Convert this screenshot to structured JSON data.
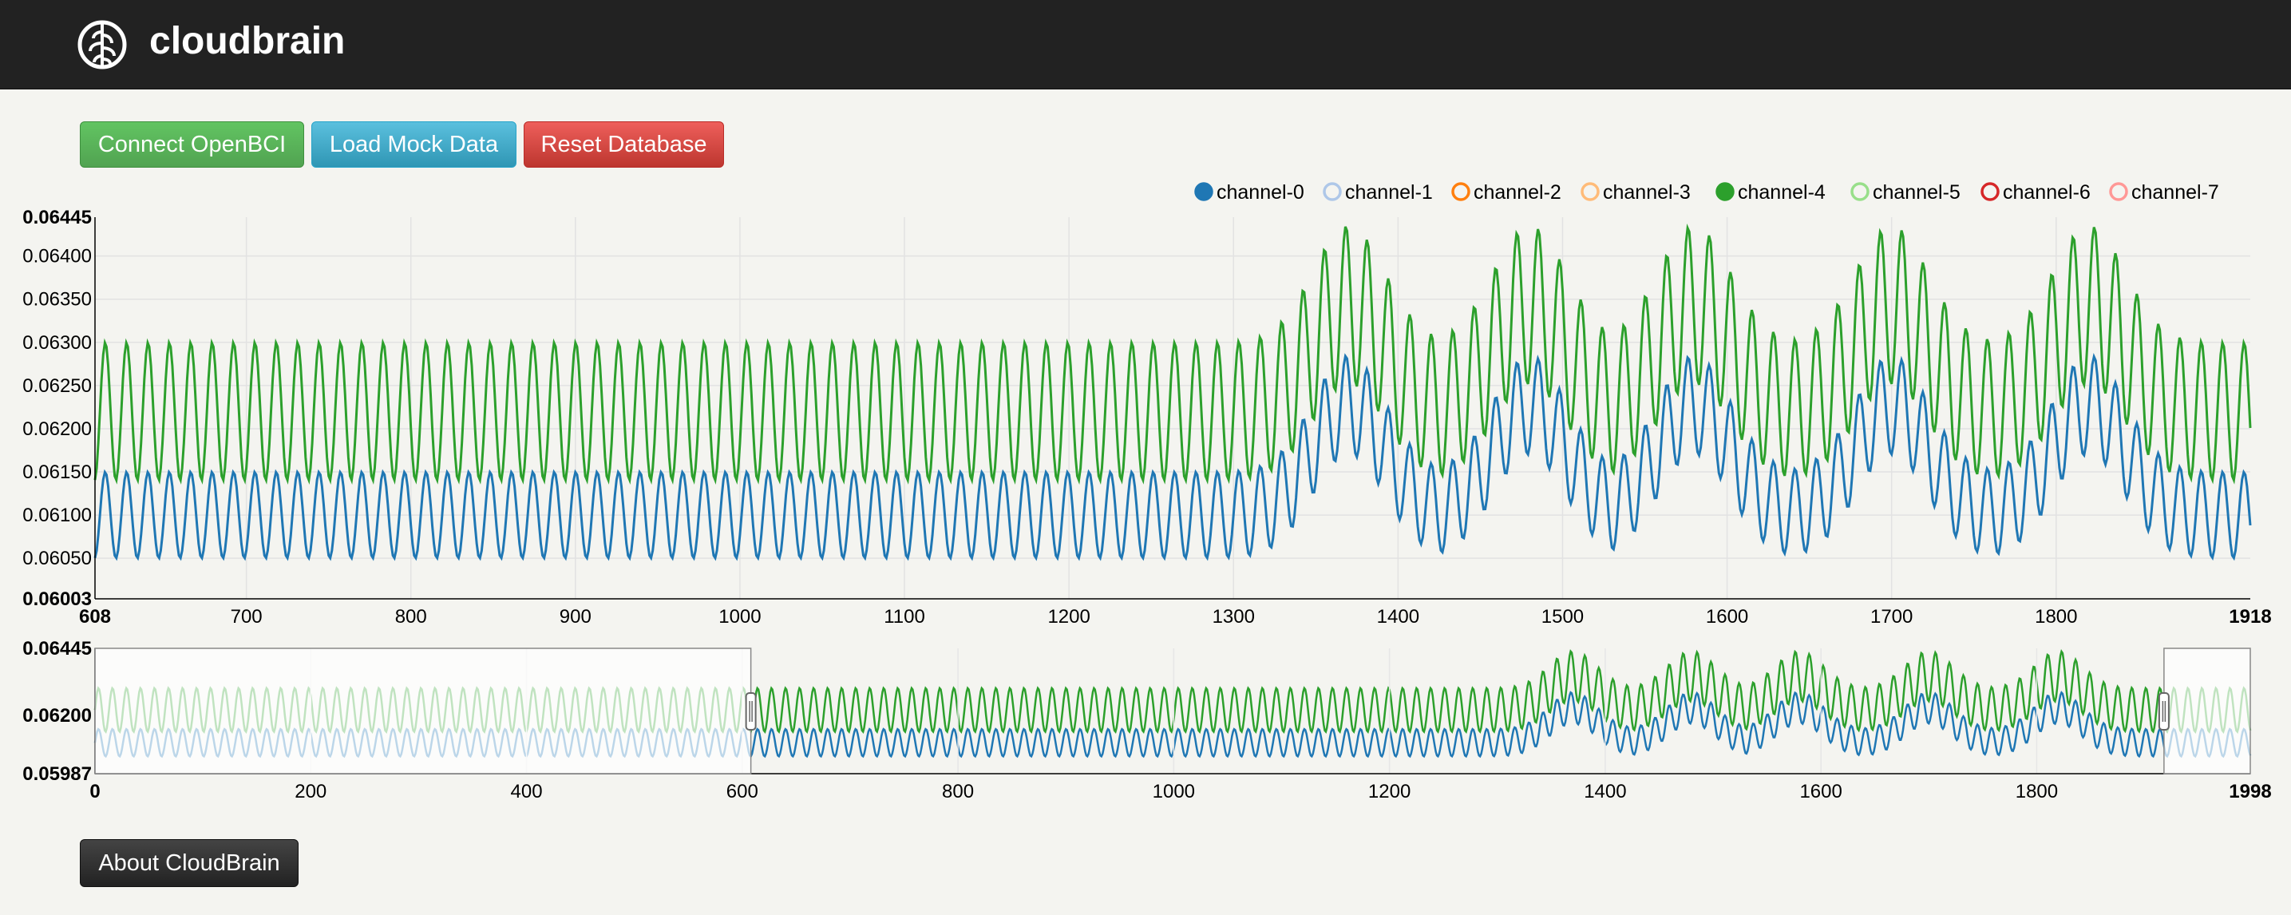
{
  "app": {
    "title": "cloudbrain",
    "logo_icon": "brain-icon"
  },
  "toolbar": {
    "connect_label": "Connect OpenBCI",
    "mock_label": "Load Mock Data",
    "reset_label": "Reset Database"
  },
  "footer": {
    "about_label": "About CloudBrain"
  },
  "colors": {
    "channel-0": "#1f77b4",
    "channel-1": "#aec7e8",
    "channel-2": "#ff7f0e",
    "channel-3": "#ffbb78",
    "channel-4": "#2ca02c",
    "channel-5": "#98df8a",
    "channel-6": "#d62728",
    "channel-7": "#ff9896"
  },
  "chart_data": [
    {
      "type": "line",
      "role": "focus",
      "legend": [
        {
          "name": "channel-0",
          "enabled": true
        },
        {
          "name": "channel-1",
          "enabled": false
        },
        {
          "name": "channel-2",
          "enabled": false
        },
        {
          "name": "channel-3",
          "enabled": false
        },
        {
          "name": "channel-4",
          "enabled": true
        },
        {
          "name": "channel-5",
          "enabled": false
        },
        {
          "name": "channel-6",
          "enabled": false
        },
        {
          "name": "channel-7",
          "enabled": false
        }
      ],
      "legend_position": "top-right",
      "xlim": [
        608,
        1918
      ],
      "ylim": [
        0.06003,
        0.06445
      ],
      "x_ticks": [
        "608",
        "700",
        "800",
        "900",
        "1000",
        "1100",
        "1200",
        "1300",
        "1400",
        "1500",
        "1600",
        "1700",
        "1800",
        "1918"
      ],
      "y_ticks": [
        "0.06445",
        "0.06400",
        "0.06350",
        "0.06300",
        "0.06250",
        "0.06200",
        "0.06150",
        "0.06100",
        "0.06050",
        "0.06003"
      ],
      "grid": true,
      "series": [
        {
          "name": "channel-0",
          "baseline_min": 0.0605,
          "baseline_max": 0.0615,
          "oscillation_period_samples": 13,
          "burst_centers_x": [
            1370,
            1480,
            1580,
            1700,
            1820
          ],
          "burst_peak": 0.063
        },
        {
          "name": "channel-4",
          "baseline_min": 0.0614,
          "baseline_max": 0.063,
          "oscillation_period_samples": 13,
          "burst_centers_x": [
            1370,
            1480,
            1580,
            1700,
            1820
          ],
          "burst_peak": 0.06445
        }
      ]
    },
    {
      "type": "line",
      "role": "context",
      "xlim": [
        0,
        1998
      ],
      "ylim": [
        0.05987,
        0.06445
      ],
      "x_ticks": [
        "0",
        "200",
        "400",
        "600",
        "800",
        "1000",
        "1200",
        "1400",
        "1600",
        "1800",
        "1998"
      ],
      "y_ticks": [
        "0.06445",
        "0.06200",
        "0.05987"
      ],
      "brush_extent": [
        608,
        1918
      ]
    }
  ]
}
